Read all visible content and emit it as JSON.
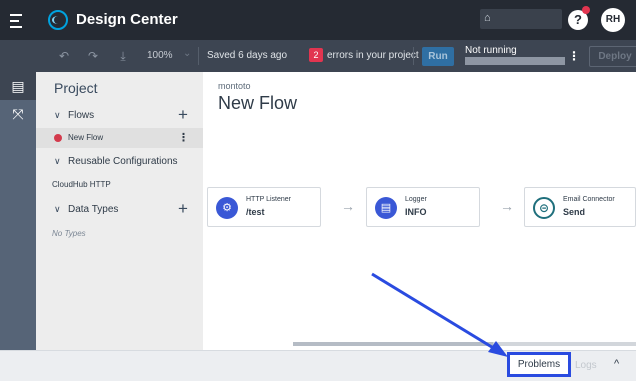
{
  "app": {
    "title": "Design Center"
  },
  "header": {
    "help_label": "?",
    "avatar_initials": "RH",
    "user_icon": "org-icon"
  },
  "toolbar": {
    "undo_icon": "undo-icon",
    "redo_icon": "redo-icon",
    "save_icon": "save-icon",
    "zoom": "100%",
    "saved_text": "Saved 6 days ago",
    "errors_count": "2",
    "errors_text": "errors in your project",
    "run_label": "Run",
    "status_text": "Not running",
    "more_icon": "kebab-icon",
    "deploy_label": "Deploy"
  },
  "rail": {
    "items": [
      {
        "icon": "document-icon",
        "glyph": "▤"
      },
      {
        "icon": "graph-icon",
        "glyph": "⤧"
      }
    ]
  },
  "project": {
    "title": "Project",
    "flows_label": "Flows",
    "flows_add": "+",
    "flow_items": [
      {
        "label": "New Flow",
        "status_color": "#d33a4c"
      }
    ],
    "reusable_label": "Reusable Configurations",
    "config_items": [
      "CloudHub HTTP"
    ],
    "datatypes_label": "Data Types",
    "datatypes_add": "+",
    "no_types": "No Types"
  },
  "canvas": {
    "breadcrumb": "montoto",
    "title": "New Flow",
    "nodes": [
      {
        "title": "HTTP Listener",
        "subtitle": "/test",
        "icon": "http-listener-icon",
        "glyph": "⚙"
      },
      {
        "title": "Logger",
        "subtitle": "INFO",
        "icon": "logger-icon",
        "glyph": "▤"
      },
      {
        "title": "Email Connector",
        "subtitle": "Send",
        "icon": "email-connector-icon",
        "glyph": "⊝"
      }
    ],
    "arrow_glyph": "→"
  },
  "bottom": {
    "problems_label": "Problems",
    "logs_label": "Logs",
    "collapse_glyph": "^"
  },
  "colors": {
    "topbar": "#252a33",
    "toolbar": "#3d4552",
    "rail": "#566477",
    "accent": "#2a4be0",
    "error": "#e23550"
  }
}
